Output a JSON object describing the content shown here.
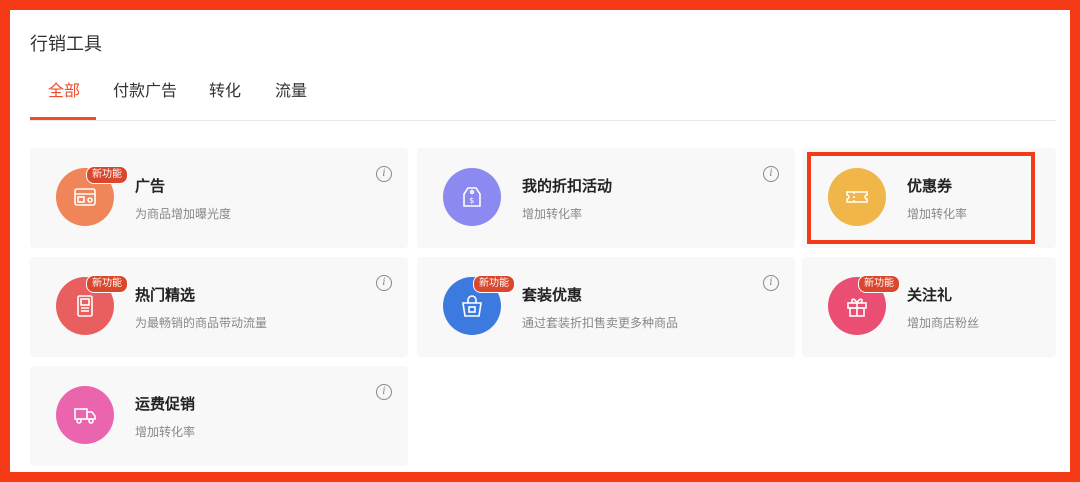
{
  "panel": {
    "title": "行销工具"
  },
  "tabs": [
    {
      "label": "全部",
      "active": true
    },
    {
      "label": "付款广告",
      "active": false
    },
    {
      "label": "转化",
      "active": false
    },
    {
      "label": "流量",
      "active": false
    }
  ],
  "cards": [
    {
      "id": "ads",
      "title": "广告",
      "desc": "为商品增加曝光度",
      "badge": "新功能",
      "icon": "ad-icon",
      "icon_color": "#f0855a"
    },
    {
      "id": "discount",
      "title": "我的折扣活动",
      "desc": "增加转化率",
      "badge": "",
      "icon": "price-tag-icon",
      "icon_color": "#8c8af0"
    },
    {
      "id": "voucher",
      "title": "优惠券",
      "desc": "增加转化率",
      "badge": "",
      "icon": "ticket-icon",
      "icon_color": "#f0b64a"
    },
    {
      "id": "hot",
      "title": "热门精选",
      "desc": "为最畅销的商品带动流量",
      "badge": "新功能",
      "icon": "showcase-icon",
      "icon_color": "#e95f5f"
    },
    {
      "id": "bundle",
      "title": "套装优惠",
      "desc": "通过套装折扣售卖更多种商品",
      "badge": "新功能",
      "icon": "shopping-bag-icon",
      "icon_color": "#3d7ae0"
    },
    {
      "id": "follow",
      "title": "关注礼",
      "desc": "增加商店粉丝",
      "badge": "新功能",
      "icon": "gift-icon",
      "icon_color": "#ea4f73"
    },
    {
      "id": "shipping",
      "title": "运费促销",
      "desc": "增加转化率",
      "badge": "",
      "icon": "truck-icon",
      "icon_color": "#ea65ae"
    }
  ],
  "info_glyph": "i",
  "highlight": {
    "color": "#f43a16"
  }
}
